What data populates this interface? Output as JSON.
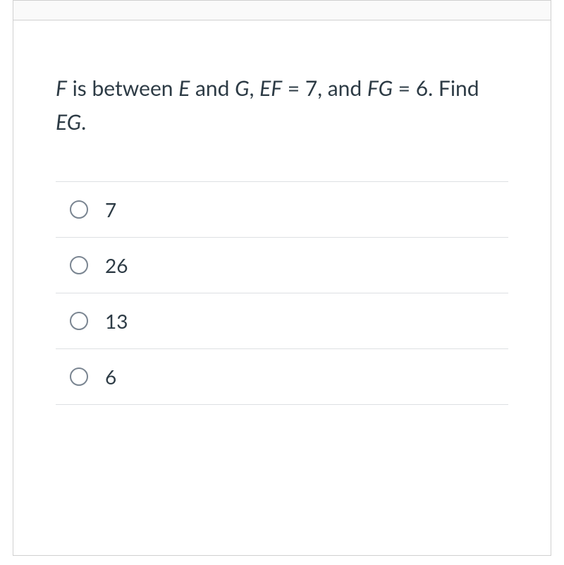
{
  "question": {
    "segments": [
      {
        "text": "F",
        "italic": true
      },
      {
        "text": " is between ",
        "italic": false
      },
      {
        "text": "E",
        "italic": true
      },
      {
        "text": " and ",
        "italic": false
      },
      {
        "text": "G",
        "italic": true
      },
      {
        "text": ", ",
        "italic": false
      },
      {
        "text": "EF",
        "italic": true
      },
      {
        "text": " = 7, and ",
        "italic": false
      },
      {
        "text": "FG",
        "italic": true
      },
      {
        "text": " = 6. Find ",
        "italic": false
      },
      {
        "text": "EG",
        "italic": true
      },
      {
        "text": ".",
        "italic": false
      }
    ]
  },
  "options": [
    {
      "label": "7"
    },
    {
      "label": "26"
    },
    {
      "label": "13"
    },
    {
      "label": "6"
    }
  ]
}
